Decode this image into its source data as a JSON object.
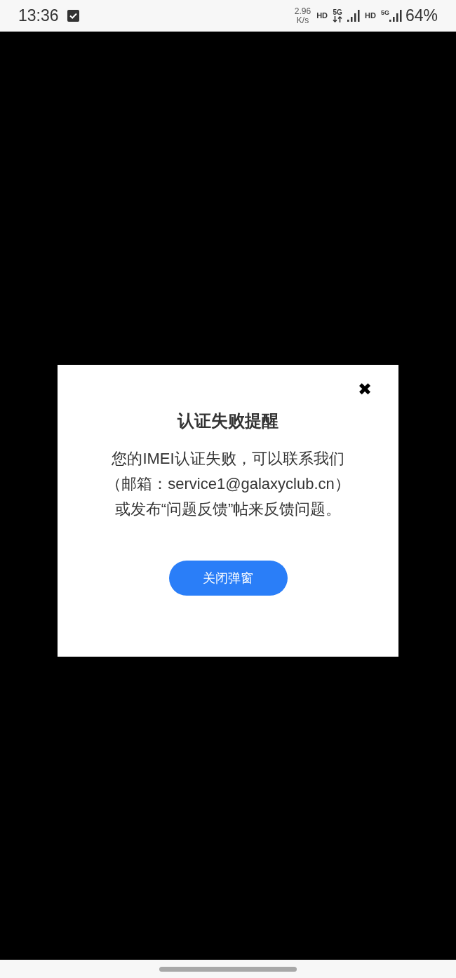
{
  "status_bar": {
    "time": "13:36",
    "speed_value": "2.96",
    "speed_unit": "K/s",
    "indicators": [
      {
        "kind": "hd",
        "label": "HD"
      },
      {
        "kind": "network_arrows",
        "label": "5G"
      },
      {
        "kind": "signal"
      },
      {
        "kind": "hd",
        "label": "HD"
      },
      {
        "kind": "network_signal",
        "label": "5G"
      }
    ],
    "battery": "64%"
  },
  "dialog": {
    "close": "✖",
    "title": "认证失败提醒",
    "message_lines": [
      "您的IMEI认证失败，可以联系我们",
      "（邮箱：service1@galaxyclub.cn）",
      "或发布“问题反馈”帖来反馈问题。"
    ],
    "button": "关闭弹窗"
  }
}
